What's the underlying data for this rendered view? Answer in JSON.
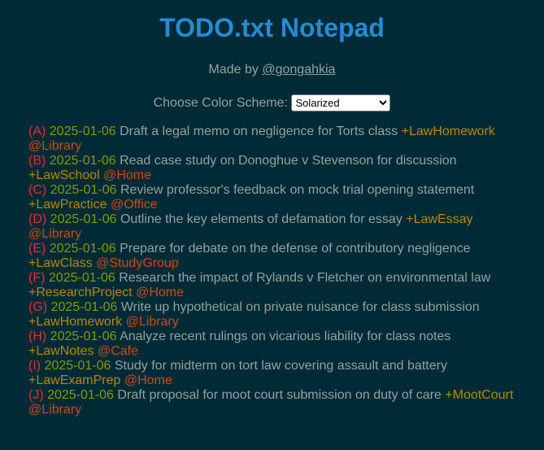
{
  "header": {
    "title": "TODO.txt Notepad",
    "made_by_prefix": "Made by ",
    "author": "@gongahkia"
  },
  "scheme": {
    "label": "Choose Color Scheme:",
    "selected": "Solarized"
  },
  "colors": {
    "background": "#002b36",
    "title": "#268bd2",
    "text": "#93a1a1",
    "priority": "#dc322f",
    "date": "#859900",
    "project": "#b58900",
    "context": "#cb4b16"
  },
  "todos": [
    {
      "priority": "(A)",
      "date": "2025-01-06",
      "text": "Draft a legal memo on negligence for Torts class",
      "project": "+LawHomework",
      "context": "@Library"
    },
    {
      "priority": "(B)",
      "date": "2025-01-06",
      "text": "Read case study on Donoghue v Stevenson for discussion",
      "project": "+LawSchool",
      "context": "@Home"
    },
    {
      "priority": "(C)",
      "date": "2025-01-06",
      "text": "Review professor's feedback on mock trial opening statement",
      "project": "+LawPractice",
      "context": "@Office"
    },
    {
      "priority": "(D)",
      "date": "2025-01-06",
      "text": "Outline the key elements of defamation for essay",
      "project": "+LawEssay",
      "context": "@Library"
    },
    {
      "priority": "(E)",
      "date": "2025-01-06",
      "text": "Prepare for debate on the defense of contributory negligence",
      "project": "+LawClass",
      "context": "@StudyGroup"
    },
    {
      "priority": "(F)",
      "date": "2025-01-06",
      "text": "Research the impact of Rylands v Fletcher on environmental law",
      "project": "+ResearchProject",
      "context": "@Home"
    },
    {
      "priority": "(G)",
      "date": "2025-01-06",
      "text": "Write up hypothetical on private nuisance for class submission",
      "project": "+LawHomework",
      "context": "@Library"
    },
    {
      "priority": "(H)",
      "date": "2025-01-06",
      "text": "Analyze recent rulings on vicarious liability for class notes",
      "project": "+LawNotes",
      "context": "@Cafe"
    },
    {
      "priority": "(I)",
      "date": "2025-01-06",
      "text": "Study for midterm on tort law covering assault and battery",
      "project": "+LawExamPrep",
      "context": "@Home"
    },
    {
      "priority": "(J)",
      "date": "2025-01-06",
      "text": "Draft proposal for moot court submission on duty of care",
      "project": "+MootCourt",
      "context": "@Library"
    }
  ]
}
